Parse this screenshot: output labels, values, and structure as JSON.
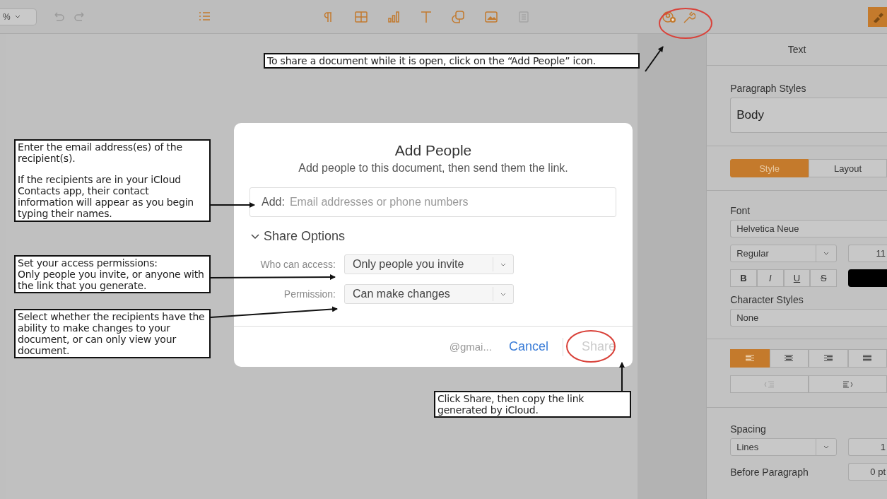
{
  "toolbar": {
    "zoom": "%"
  },
  "sidebar": {
    "title": "Text",
    "paragraph_styles_label": "Paragraph Styles",
    "paragraph_style": "Body",
    "tabs": [
      {
        "label": "Style",
        "selected": true
      },
      {
        "label": "Layout",
        "selected": false
      }
    ],
    "font_label": "Font",
    "font_family": "Helvetica Neue",
    "font_typeface": "Regular",
    "font_size": "11",
    "format_buttons": [
      {
        "kind": "bold",
        "label": "B"
      },
      {
        "kind": "italic",
        "label": "I"
      },
      {
        "kind": "underline",
        "label": "U"
      },
      {
        "kind": "strike",
        "label": "S"
      }
    ],
    "character_styles_label": "Character Styles",
    "character_style": "None",
    "alignment": [
      {
        "kind": "left",
        "selected": true
      },
      {
        "kind": "center",
        "selected": false
      },
      {
        "kind": "right",
        "selected": false
      },
      {
        "kind": "justify",
        "selected": false
      }
    ],
    "indent": [
      {
        "kind": "decrease",
        "disabled": true
      },
      {
        "kind": "increase",
        "disabled": false
      }
    ],
    "spacing_label": "Spacing",
    "spacing_mode": "Lines",
    "spacing_value": "1",
    "before_paragraph_label": "Before Paragraph",
    "before_paragraph_value": "0 pt"
  },
  "dialog": {
    "title": "Add People",
    "subtitle": "Add people to this document, then send them the link.",
    "add_label": "Add:",
    "add_placeholder": "Email addresses or phone numbers",
    "share_options": {
      "label": "Share Options",
      "expanded": true
    },
    "options": [
      {
        "label": "Who can access:",
        "value": "Only people you invite"
      },
      {
        "label": "Permission:",
        "value": "Can make changes"
      }
    ],
    "account": "@gmai...",
    "cancel": "Cancel",
    "share": {
      "label": "Share",
      "disabled": true
    }
  },
  "annotations": [
    {
      "paragraphs": [
        "To share a document while it is open, click on the “Add People” icon."
      ]
    },
    {
      "paragraphs": [
        "Enter the email address(es) of the recipient(s).",
        "If the recipients are in your iCloud Contacts app, their contact information will appear as you begin typing their names."
      ]
    },
    {
      "paragraphs": [
        "Set your access permissions:\nOnly people you invite, or anyone with the link that you generate."
      ]
    },
    {
      "paragraphs": [
        "Select whether the recipients have the ability to make changes to your document, or can only view your document."
      ]
    },
    {
      "paragraphs": [
        "Click Share, then copy the link generated by iCloud."
      ]
    }
  ]
}
